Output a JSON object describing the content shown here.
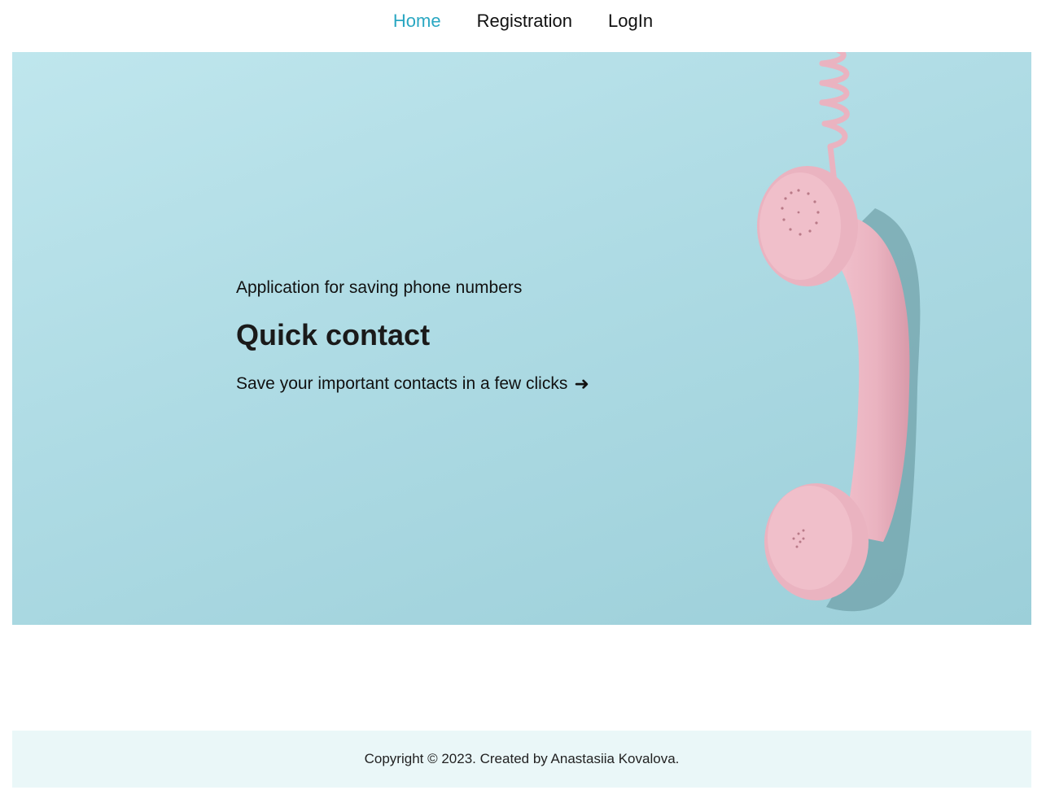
{
  "nav": {
    "items": [
      {
        "label": "Home",
        "active": true
      },
      {
        "label": "Registration",
        "active": false
      },
      {
        "label": "LogIn",
        "active": false
      }
    ],
    "active_color": "#2aa7c2"
  },
  "hero": {
    "subtitle": "Application for saving phone numbers",
    "title": "Quick contact",
    "tagline": "Save your important contacts in a few clicks",
    "tagline_icon": "right-arrow-icon",
    "background_color": "#aedbe4",
    "image": "pink-telephone-handset"
  },
  "footer": {
    "text": "Copyright © 2023. Created by Anastasiia Kovalova."
  }
}
